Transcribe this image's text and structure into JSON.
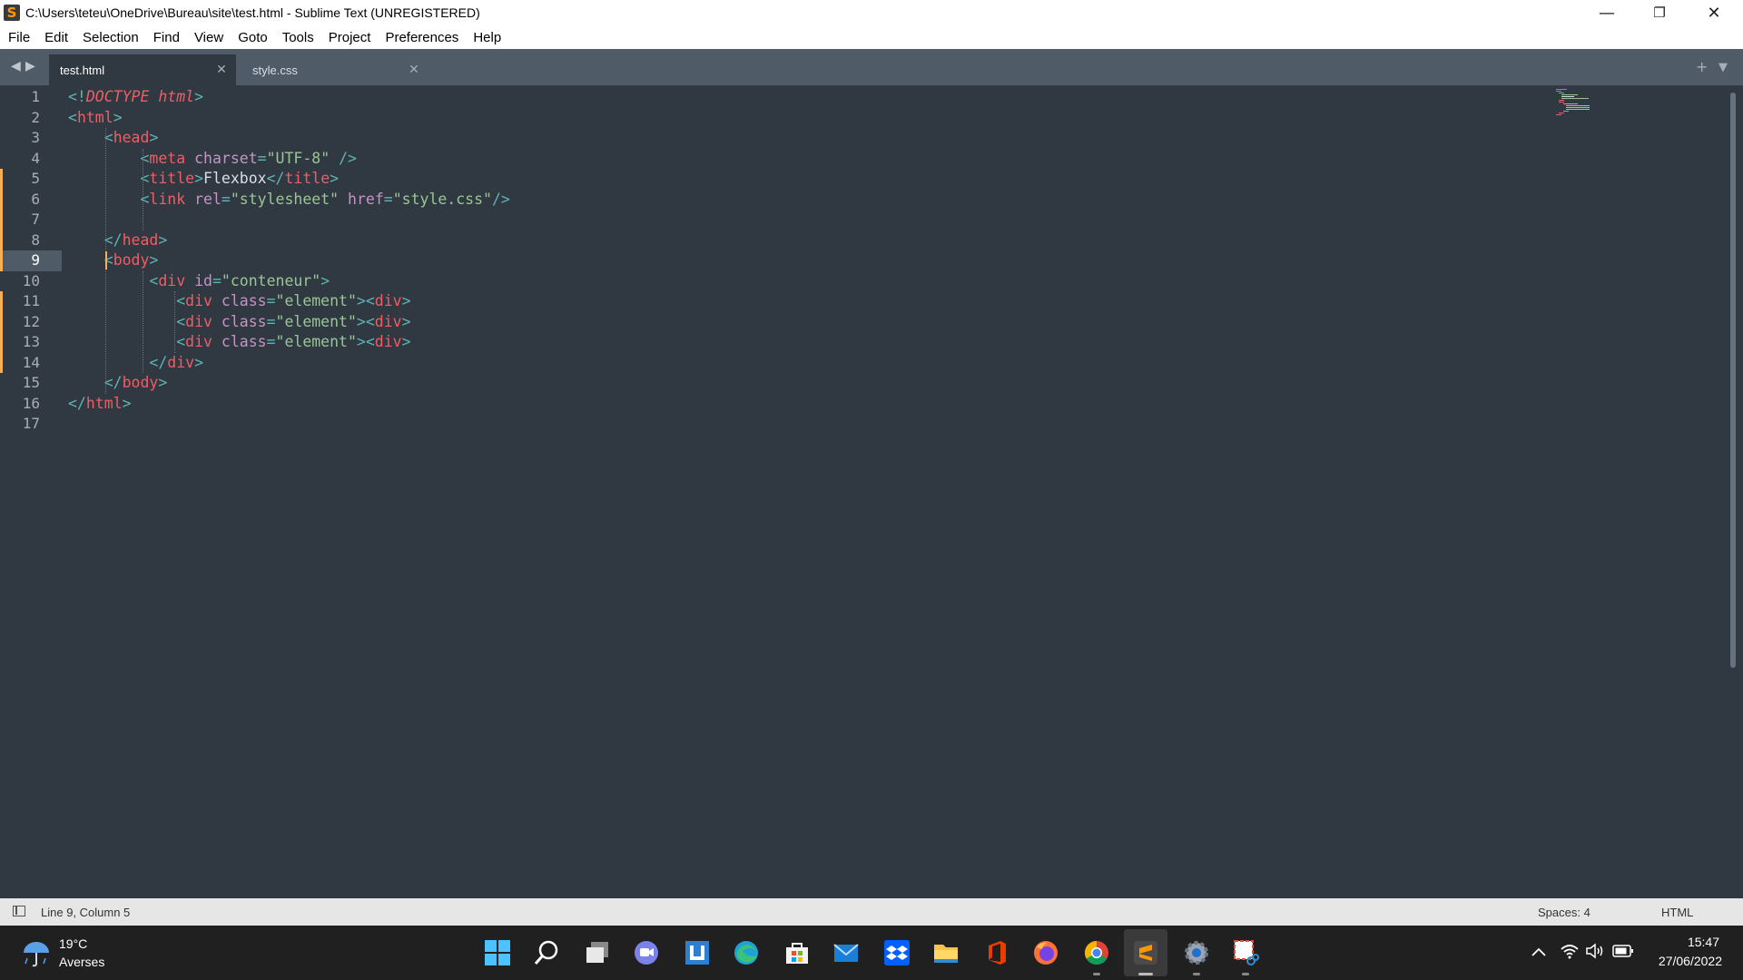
{
  "window": {
    "title": "C:\\Users\\teteu\\OneDrive\\Bureau\\site\\test.html - Sublime Text (UNREGISTERED)",
    "minimize": "—",
    "restore": "❐",
    "close": "✕"
  },
  "app_icon_glyph": "S",
  "menu": [
    "File",
    "Edit",
    "Selection",
    "Find",
    "View",
    "Goto",
    "Tools",
    "Project",
    "Preferences",
    "Help"
  ],
  "tabs": [
    {
      "label": "test.html",
      "active": true
    },
    {
      "label": "style.css",
      "active": false
    }
  ],
  "tab_close": "✕",
  "tab_add": "+",
  "tab_menu": "▼",
  "nav_prev": "◀",
  "nav_next": "▶",
  "editor": {
    "current_line": 9,
    "line_numbers": [
      "1",
      "2",
      "3",
      "4",
      "5",
      "6",
      "7",
      "8",
      "9",
      "10",
      "11",
      "12",
      "13",
      "14",
      "15",
      "16",
      "17"
    ],
    "lines": [
      [
        [
          "punc",
          "<!"
        ],
        [
          "doctype",
          "DOCTYPE html"
        ],
        [
          "punc",
          ">"
        ]
      ],
      [
        [
          "punc",
          "<"
        ],
        [
          "tag",
          "html"
        ],
        [
          "punc",
          ">"
        ]
      ],
      [
        [
          "txt",
          "    "
        ],
        [
          "punc",
          "<"
        ],
        [
          "tag",
          "head"
        ],
        [
          "punc",
          ">"
        ]
      ],
      [
        [
          "txt",
          "        "
        ],
        [
          "punc",
          "<"
        ],
        [
          "tag",
          "meta"
        ],
        [
          "txt",
          " "
        ],
        [
          "attr",
          "charset"
        ],
        [
          "punc",
          "="
        ],
        [
          "str",
          "\"UTF-8\""
        ],
        [
          "txt",
          " "
        ],
        [
          "punc",
          "/>"
        ]
      ],
      [
        [
          "txt",
          "        "
        ],
        [
          "punc",
          "<"
        ],
        [
          "tag",
          "title"
        ],
        [
          "punc",
          ">"
        ],
        [
          "txt",
          "Flexbox"
        ],
        [
          "punc",
          "</"
        ],
        [
          "tag",
          "title"
        ],
        [
          "punc",
          ">"
        ]
      ],
      [
        [
          "txt",
          "        "
        ],
        [
          "punc",
          "<"
        ],
        [
          "tag",
          "link"
        ],
        [
          "txt",
          " "
        ],
        [
          "attr",
          "rel"
        ],
        [
          "punc",
          "="
        ],
        [
          "str",
          "\"stylesheet\""
        ],
        [
          "txt",
          " "
        ],
        [
          "attr",
          "href"
        ],
        [
          "punc",
          "="
        ],
        [
          "str",
          "\"style.css\""
        ],
        [
          "punc",
          "/>"
        ]
      ],
      [
        [
          "txt",
          ""
        ]
      ],
      [
        [
          "txt",
          "    "
        ],
        [
          "punc",
          "</"
        ],
        [
          "tag",
          "head"
        ],
        [
          "punc",
          ">"
        ]
      ],
      [
        [
          "txt",
          "    "
        ],
        [
          "punc",
          "<"
        ],
        [
          "tag",
          "body"
        ],
        [
          "punc",
          ">"
        ]
      ],
      [
        [
          "txt",
          "         "
        ],
        [
          "punc",
          "<"
        ],
        [
          "tag",
          "div"
        ],
        [
          "txt",
          " "
        ],
        [
          "attr",
          "id"
        ],
        [
          "punc",
          "="
        ],
        [
          "str",
          "\"conteneur\""
        ],
        [
          "punc",
          ">"
        ]
      ],
      [
        [
          "txt",
          "            "
        ],
        [
          "punc",
          "<"
        ],
        [
          "tag",
          "div"
        ],
        [
          "txt",
          " "
        ],
        [
          "attr",
          "class"
        ],
        [
          "punc",
          "="
        ],
        [
          "str",
          "\"element\""
        ],
        [
          "punc",
          "><"
        ],
        [
          "tag",
          "div"
        ],
        [
          "punc",
          ">"
        ]
      ],
      [
        [
          "txt",
          "            "
        ],
        [
          "punc",
          "<"
        ],
        [
          "tag",
          "div"
        ],
        [
          "txt",
          " "
        ],
        [
          "attr",
          "class"
        ],
        [
          "punc",
          "="
        ],
        [
          "str",
          "\"element\""
        ],
        [
          "punc",
          "><"
        ],
        [
          "tag",
          "div"
        ],
        [
          "punc",
          ">"
        ]
      ],
      [
        [
          "txt",
          "            "
        ],
        [
          "punc",
          "<"
        ],
        [
          "tag",
          "div"
        ],
        [
          "txt",
          " "
        ],
        [
          "attr",
          "class"
        ],
        [
          "punc",
          "="
        ],
        [
          "str",
          "\"element\""
        ],
        [
          "punc",
          "><"
        ],
        [
          "tag",
          "div"
        ],
        [
          "punc",
          ">"
        ]
      ],
      [
        [
          "txt",
          "         "
        ],
        [
          "punc",
          "</"
        ],
        [
          "tag",
          "div"
        ],
        [
          "punc",
          ">"
        ]
      ],
      [
        [
          "txt",
          "    "
        ],
        [
          "punc",
          "</"
        ],
        [
          "tag",
          "body"
        ],
        [
          "punc",
          ">"
        ]
      ],
      [
        [
          "punc",
          "</"
        ],
        [
          "tag",
          "html"
        ],
        [
          "punc",
          ">"
        ]
      ],
      [
        [
          "txt",
          ""
        ]
      ]
    ]
  },
  "status": {
    "position": "Line 9, Column 5",
    "indentation": "Spaces: 4",
    "syntax": "HTML"
  },
  "taskbar": {
    "weather_temp": "19°C",
    "weather_desc": "Averses",
    "time": "15:47",
    "date": "27/06/2022",
    "apps": [
      "start-icon",
      "search-icon",
      "task-view-icon",
      "chat-icon",
      "store-app-icon",
      "edge-icon",
      "microsoft-store-icon",
      "mail-icon",
      "dropbox-icon",
      "file-explorer-icon",
      "office-icon",
      "firefox-icon",
      "chrome-icon",
      "sublime-text-icon",
      "settings-icon",
      "snipping-tool-icon"
    ]
  },
  "colors": {
    "editor_bg": "#303841",
    "tab_bar": "#4f5b66",
    "tag": "#ec5f66",
    "punctuation": "#5fb4b4",
    "attribute": "#c594c5",
    "string": "#99c794",
    "git_modified": "#f9ae58"
  }
}
